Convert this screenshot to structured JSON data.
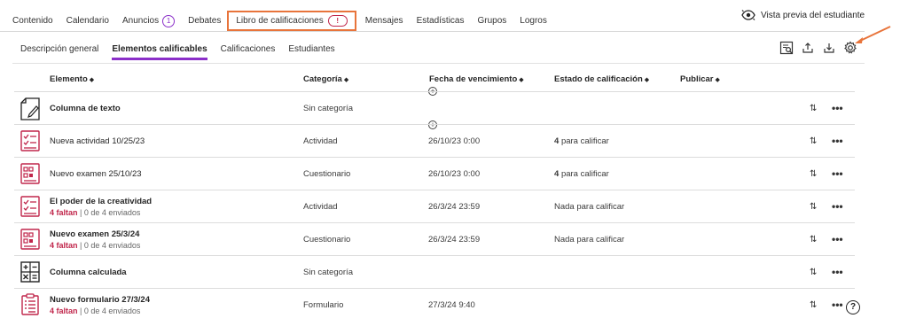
{
  "topnav": {
    "items": [
      {
        "label": "Contenido"
      },
      {
        "label": "Calendario"
      },
      {
        "label": "Anuncios",
        "badge": "1"
      },
      {
        "label": "Debates"
      },
      {
        "label": "Libro de calificaciones",
        "badge": "!"
      },
      {
        "label": "Mensajes"
      },
      {
        "label": "Estadísticas"
      },
      {
        "label": "Grupos"
      },
      {
        "label": "Logros"
      }
    ],
    "preview_label": "Vista previa del estudiante"
  },
  "subtabs": [
    {
      "label": "Descripción general"
    },
    {
      "label": "Elementos calificables"
    },
    {
      "label": "Calificaciones"
    },
    {
      "label": "Estudiantes"
    }
  ],
  "table": {
    "headers": {
      "element": "Elemento",
      "category": "Categoría",
      "due": "Fecha de vencimiento",
      "status": "Estado de calificación",
      "publish": "Publicar"
    },
    "rows": [
      {
        "name": "Columna de texto",
        "category": "Sin categoría",
        "due": "",
        "status_count": "",
        "status_text": ""
      },
      {
        "name": "Nueva actividad 10/25/23",
        "category": "Actividad",
        "due": "26/10/23 0:00",
        "status_count": "4",
        "status_text": "para calificar"
      },
      {
        "name": "Nuevo examen 25/10/23",
        "category": "Cuestionario",
        "due": "26/10/23 0:00",
        "status_count": "4",
        "status_text": "para calificar"
      },
      {
        "name": "El poder de la creatividad",
        "missing": "4 faltan",
        "submitted": "| 0 de 4 enviados",
        "category": "Actividad",
        "due": "26/3/24 23:59",
        "status_count": "",
        "status_text": "Nada para calificar"
      },
      {
        "name": "Nuevo examen 25/3/24",
        "missing": "4 faltan",
        "submitted": "| 0 de 4 enviados",
        "category": "Cuestionario",
        "due": "26/3/24 23:59",
        "status_count": "",
        "status_text": "Nada para calificar"
      },
      {
        "name": "Columna calculada",
        "category": "Sin categoría",
        "due": "",
        "status_count": "",
        "status_text": ""
      },
      {
        "name": "Nuevo formulario 27/3/24",
        "missing": "4 faltan",
        "submitted": "| 0 de 4 enviados",
        "category": "Formulario",
        "due": "27/3/24 9:40",
        "status_count": "",
        "status_text": ""
      }
    ]
  },
  "icons": {
    "sort": "⇅",
    "more": "•••",
    "help": "?",
    "plus": "+"
  },
  "colors": {
    "accent": "#8b2fc9",
    "highlight": "#e8743b",
    "alert": "#c0264b"
  }
}
